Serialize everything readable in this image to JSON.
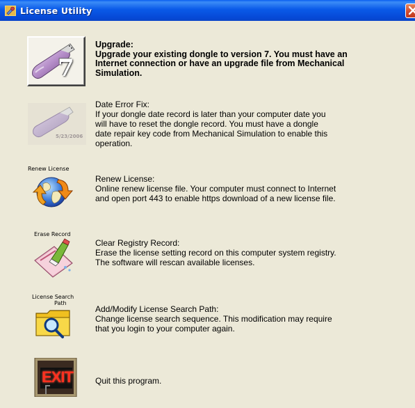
{
  "window": {
    "title": "License Utility",
    "icons": {
      "app": "key-app-icon",
      "close": "close-icon"
    }
  },
  "items": [
    {
      "title": "Upgrade:",
      "lines": [
        "Upgrade your existing dongle to version 7. You must have an",
        "Internet connection or have an upgrade file from Mechanical",
        "Simulation."
      ],
      "icon": "usb-dongle-upgrade-icon",
      "badge": "7"
    },
    {
      "title": "Date Error Fix:",
      "lines": [
        "If your dongle date record is later than your computer date you",
        "will have to reset the dongle record. You must have a dongle",
        "date repair key code from Mechanical Simulation to enable this",
        "operation."
      ],
      "icon": "usb-dongle-date-icon",
      "icon_text": "5/23/2006"
    },
    {
      "title": "Renew License:",
      "lines": [
        "Online renew license file. Your computer must connect to Internet",
        "and open port 443 to enable https download of a new license file."
      ],
      "icon": "globe-renew-icon",
      "caption": "Renew License"
    },
    {
      "title": "Clear Registry Record:",
      "lines": [
        "Erase the license setting record on this computer system registry.",
        "The software will rescan available licenses."
      ],
      "icon": "eraser-icon",
      "caption": "Erase Record"
    },
    {
      "title": "Add/Modify License Search Path:",
      "lines": [
        "Change license search sequence. This modification may require",
        "that you login to your computer again."
      ],
      "icon": "folder-search-icon",
      "caption_line1": "License Search",
      "caption_line2": "Path"
    },
    {
      "title": "Quit this program.",
      "lines": [],
      "icon": "exit-sign-icon",
      "icon_text": "EXIT"
    }
  ],
  "colors": {
    "titlebar": "#0a5ae8",
    "background": "#ece9d8"
  }
}
